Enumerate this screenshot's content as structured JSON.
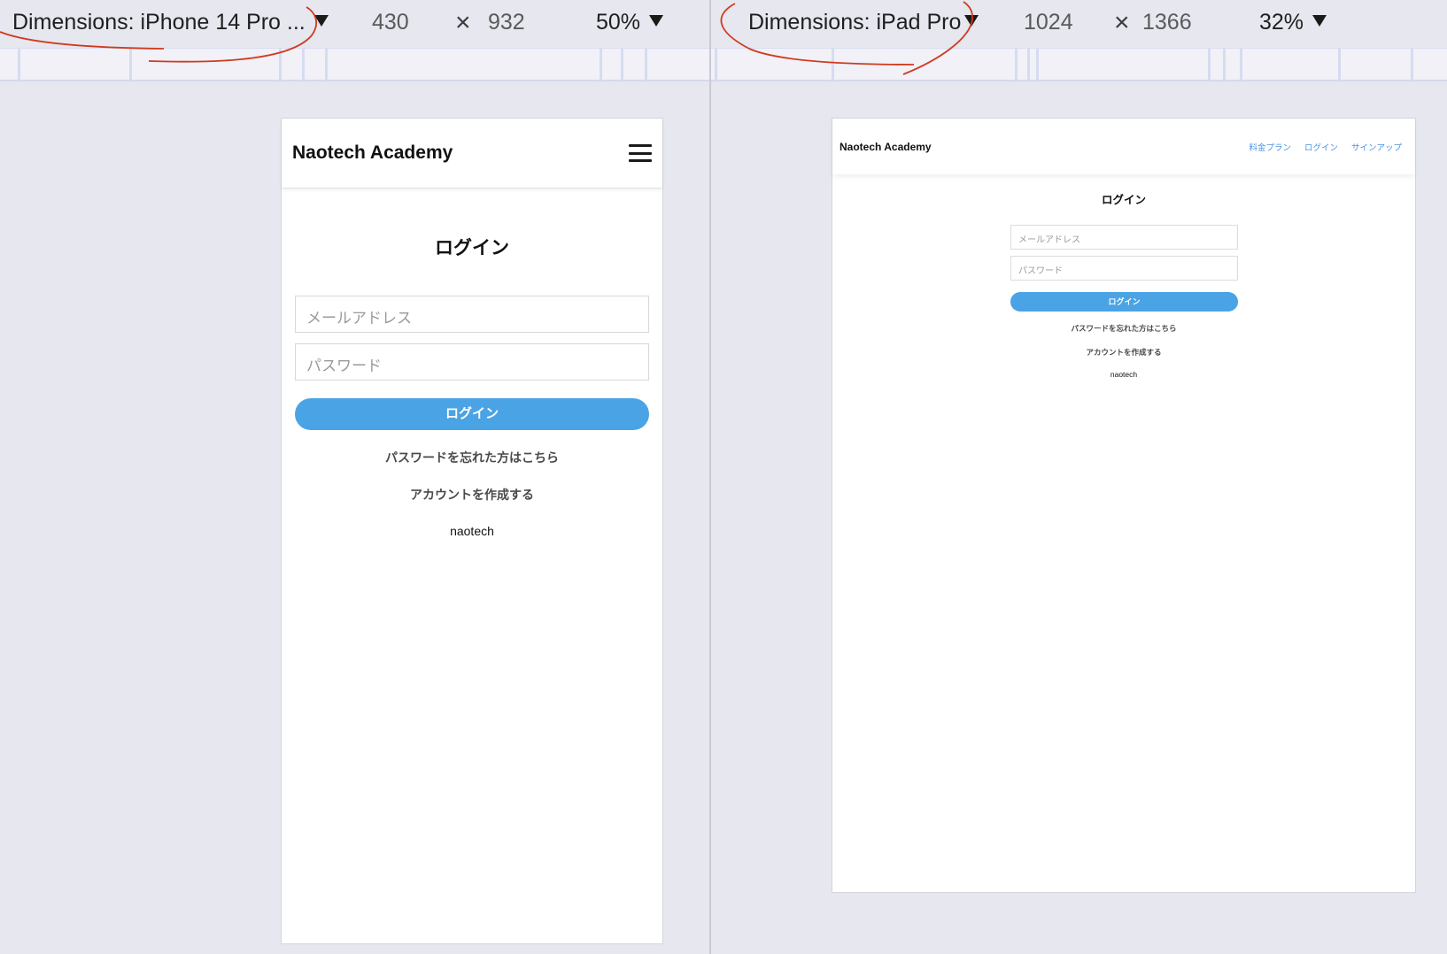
{
  "left_pane": {
    "device_label": "Dimensions: iPhone 14 Pro ...",
    "width": "430",
    "height": "932",
    "zoom": "50%",
    "page": {
      "brand": "Naotech Academy",
      "title": "ログイン",
      "email_placeholder": "メールアドレス",
      "password_placeholder": "パスワード",
      "login_button": "ログイン",
      "forgot_link": "パスワードを忘れた方はこちら",
      "signup_link": "アカウントを作成する",
      "footer": "naotech"
    }
  },
  "right_pane": {
    "device_label": "Dimensions: iPad Pro",
    "width": "1024",
    "height": "1366",
    "zoom": "32%",
    "page": {
      "brand": "Naotech Academy",
      "nav_links": [
        "料金プラン",
        "ログイン",
        "サインアップ"
      ],
      "title": "ログイン",
      "email_placeholder": "メールアドレス",
      "password_placeholder": "パスワード",
      "login_button": "ログイン",
      "forgot_link": "パスワードを忘れた方はこちら",
      "signup_link": "アカウントを作成する",
      "footer": "naotech"
    }
  },
  "times_symbol": "×",
  "colors": {
    "accent": "#4aa3e4",
    "nav_link": "#4a90e2",
    "annotation": "#d03a1e",
    "canvas": "#e6e7ef"
  }
}
